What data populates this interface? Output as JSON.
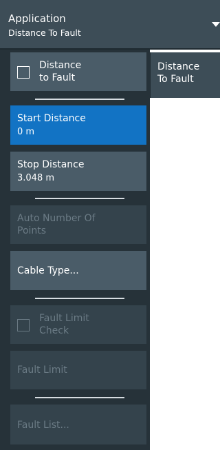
{
  "header": {
    "title": "Application",
    "subtitle": "Distance To Fault",
    "dropdown_icon": "triangle-down"
  },
  "side_tab": {
    "line1": "Distance",
    "line2": "To Fault"
  },
  "softkeys": {
    "distance_to_fault": {
      "line1": "Distance",
      "line2": "to Fault",
      "checked": false
    },
    "start_distance": {
      "label": "Start Distance",
      "value": "0 m",
      "state": "active"
    },
    "stop_distance": {
      "label": "Stop Distance",
      "value": "3.048 m"
    },
    "auto_number_points": {
      "line1": "Auto Number Of",
      "line2": "Points",
      "state": "disabled"
    },
    "cable_type": {
      "label": "Cable Type..."
    },
    "fault_limit_check": {
      "line1": "Fault Limit",
      "line2": "Check",
      "checked": false,
      "state": "disabled"
    },
    "fault_limit": {
      "label": "Fault Limit",
      "state": "disabled"
    },
    "fault_list": {
      "label": "Fault List...",
      "state": "disabled"
    }
  },
  "colors": {
    "panel_bg": "#263239",
    "key_bg": "#4a5c68",
    "active_bg": "#1273c4",
    "disabled_text": "#6b7b85"
  }
}
